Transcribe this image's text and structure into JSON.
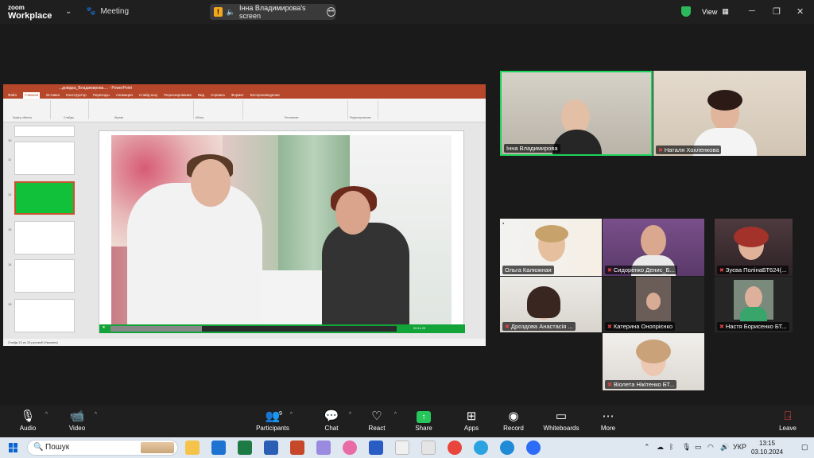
{
  "topbar": {
    "logo_line1": "zoom",
    "logo_line2": "Workplace",
    "meeting_label": "Meeting",
    "screen_label": "Інна Владимирова's screen",
    "view_label": "View"
  },
  "shared_screen": {
    "ppt_title": "...довідка_Владимирова.... - PowerPoint",
    "ppt_tabs": [
      "Файл",
      "Главная",
      "Вставка",
      "Конструктор",
      "Переходы",
      "Анимация",
      "Слайд-шоу",
      "Рецензирование",
      "Вид",
      "Справка",
      "Формат",
      "Воспроизведение"
    ],
    "ribbon_groups": [
      "Буфер обмена",
      "Слайды",
      "Шрифт",
      "Абзац",
      "Рисование",
      "Редактирование"
    ],
    "thumb_numbers": [
      "10",
      "11",
      "12",
      "13",
      "14",
      "15",
      "16"
    ],
    "video_time": "00:11:29",
    "status_text": "Слайд 13 из 15    русский (Украина)",
    "video_progress": 0.32
  },
  "participants": {
    "large": [
      {
        "name": "Інна Владимирова",
        "muted": false
      },
      {
        "name": "Наталя Хохленкова",
        "muted": true
      }
    ],
    "grid": [
      {
        "name": "Ольга Калюжная",
        "muted": false
      },
      {
        "name": "Сидоренко Денис_Б...",
        "muted": true
      },
      {
        "name": "Зуєва ПолінаБТ624(...",
        "muted": true
      },
      {
        "name": "Дроздова Анастасія ...",
        "muted": true
      },
      {
        "name": "Катерина Онопрієнко",
        "muted": true
      },
      {
        "name": "Настя Борисенко БТ...",
        "muted": true
      },
      {
        "name": "Віолета Нікітенко БТ...",
        "muted": true
      }
    ]
  },
  "toolbar": {
    "audio": "Audio",
    "video": "Video",
    "participants": "Participants",
    "participants_count": "9",
    "chat": "Chat",
    "react": "React",
    "share": "Share",
    "apps": "Apps",
    "record": "Record",
    "whiteboards": "Whiteboards",
    "more": "More",
    "leave": "Leave"
  },
  "taskbar": {
    "search_placeholder": "Пошук",
    "language": "УКР",
    "time": "13:15",
    "date": "03.10.2024"
  },
  "colors": {
    "active_speaker_border": "#1dd35b",
    "share_green": "#27c65a",
    "ppt_red": "#b7472a",
    "muted_red": "#e64545"
  }
}
